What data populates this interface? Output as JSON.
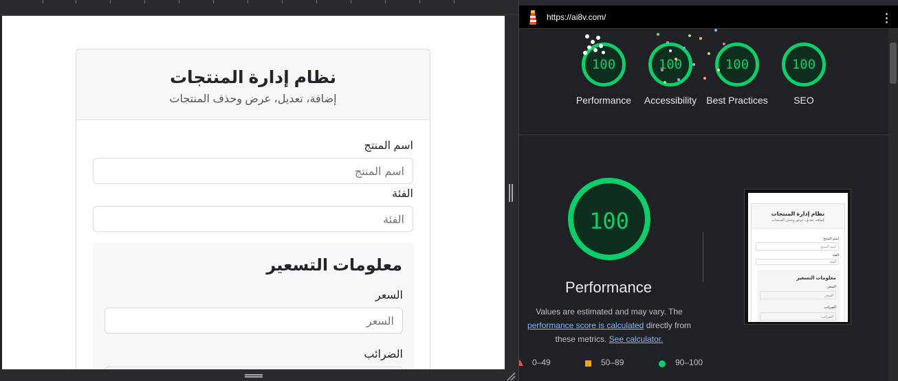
{
  "app": {
    "card_title": "نظام إدارة المنتجات",
    "card_subtitle": "إضافة، تعديل، عرض وحذف المنتجات",
    "fields": {
      "name_label": "اسم المنتج",
      "name_placeholder": "اسم المنتج",
      "category_label": "الفئة",
      "category_placeholder": "الفئة"
    },
    "pricing": {
      "title": "معلومات التسعير",
      "price_label": "السعر",
      "price_placeholder": "السعر",
      "tax_label": "الضرائب"
    }
  },
  "lighthouse": {
    "url": "https://ai8v.com/",
    "categories": [
      {
        "label": "Performance",
        "score": "100"
      },
      {
        "label": "Accessibility",
        "score": "100"
      },
      {
        "label": "Best Practices",
        "score": "100"
      },
      {
        "label": "SEO",
        "score": "100"
      }
    ],
    "main_score": "100",
    "main_title": "Performance",
    "note_prefix": "Values are estimated and may vary. The",
    "note_link": "performance score is calculated",
    "note_middle": "directly from these metrics.",
    "note_link2": "See calculator.",
    "legend": {
      "red": "0–49",
      "orange": "50–89",
      "green": "90–100"
    },
    "colors": {
      "pass": "#0cce6b",
      "average": "#ffa400",
      "fail": "#ff4e42"
    }
  },
  "thumbnail": {
    "title": "نظام إدارة المنتجات",
    "subtitle": "إضافة، تعديل، عرض وحذف المنتجات",
    "name_label": "اسم المنتج",
    "name_placeholder": "اسم المنتج",
    "category_label": "الفئة",
    "category_placeholder": "الفئة",
    "pricing_title": "معلومات التسعير",
    "price_label": "السعر",
    "price_placeholder": "السعر",
    "tax_label": "الضرائب",
    "tax_placeholder": "الضرائب"
  }
}
